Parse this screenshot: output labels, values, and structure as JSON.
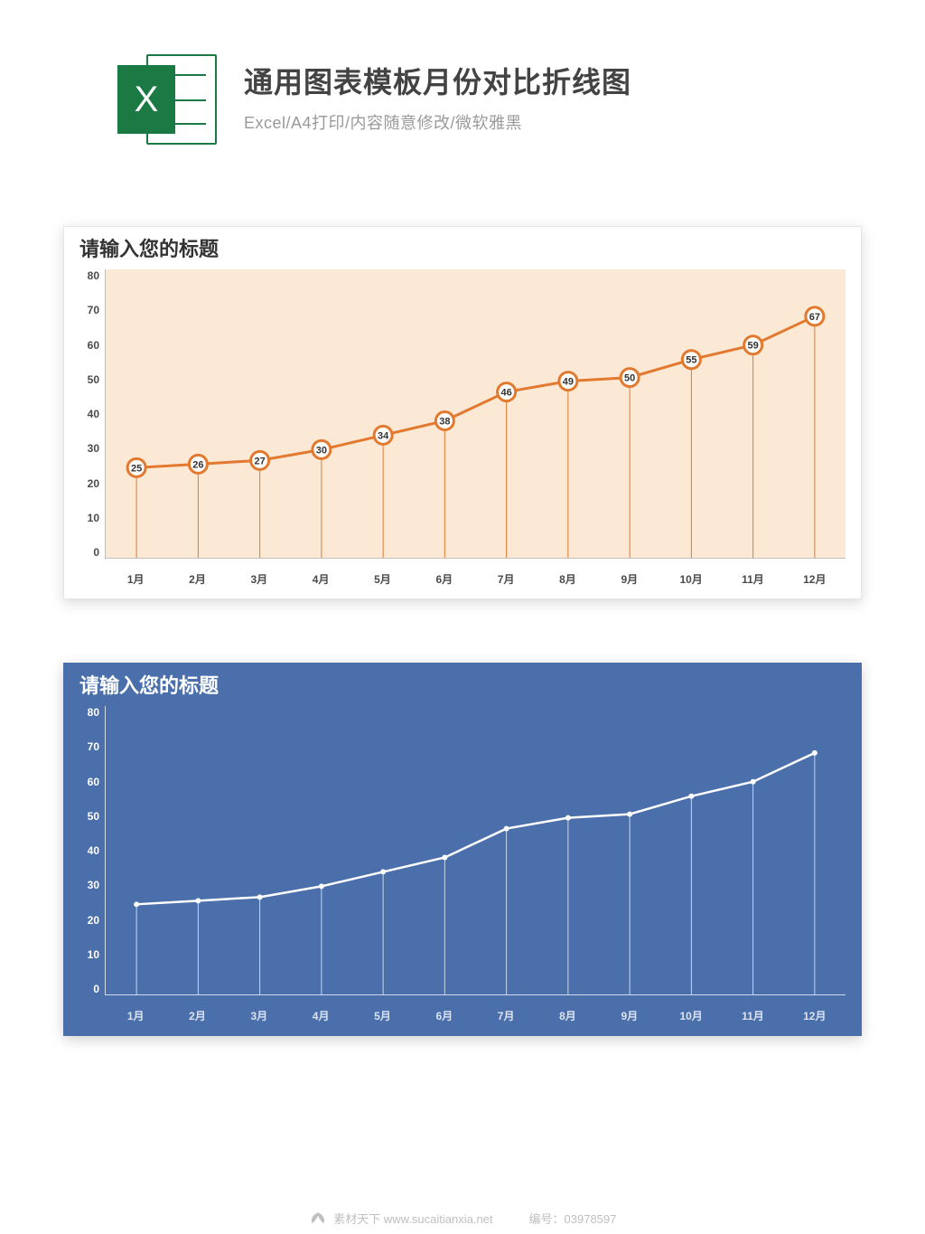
{
  "header": {
    "title": "通用图表模板月份对比折线图",
    "subtitle": "Excel/A4打印/内容随意修改/微软雅黑",
    "excel_letter": "X"
  },
  "charts": [
    {
      "title": "请输入您的标题",
      "theme": "light",
      "y_ticks": [
        "80",
        "70",
        "60",
        "50",
        "40",
        "30",
        "20",
        "10",
        "0"
      ],
      "x_ticks": [
        "1月",
        "2月",
        "3月",
        "4月",
        "5月",
        "6月",
        "7月",
        "8月",
        "9月",
        "10月",
        "11月",
        "12月"
      ],
      "values": [
        25,
        26,
        27,
        30,
        34,
        38,
        46,
        49,
        50,
        55,
        59,
        67
      ],
      "colors": {
        "line": "#e3792e",
        "marker_fill": "#fff",
        "marker_stroke": "#e3792e",
        "drop": "#e3792e",
        "label": "#333"
      }
    },
    {
      "title": "请输入您的标题",
      "theme": "blue",
      "y_ticks": [
        "80",
        "70",
        "60",
        "50",
        "40",
        "30",
        "20",
        "10",
        "0"
      ],
      "x_ticks": [
        "1月",
        "2月",
        "3月",
        "4月",
        "5月",
        "6月",
        "7月",
        "8月",
        "9月",
        "10月",
        "11月",
        "12月"
      ],
      "values": [
        25,
        26,
        27,
        30,
        34,
        38,
        46,
        49,
        50,
        55,
        59,
        67
      ],
      "colors": {
        "line": "#ffffff",
        "marker_fill": "#fff",
        "marker_stroke": "#fff",
        "drop": "#c9d4e8",
        "label": ""
      }
    }
  ],
  "footer": {
    "site": "素材天下 www.sucaitianxia.net",
    "id_label": "编号：",
    "id": "03978597"
  },
  "chart_data": [
    {
      "type": "line",
      "title": "请输入您的标题",
      "categories": [
        "1月",
        "2月",
        "3月",
        "4月",
        "5月",
        "6月",
        "7月",
        "8月",
        "9月",
        "10月",
        "11月",
        "12月"
      ],
      "values": [
        25,
        26,
        27,
        30,
        34,
        38,
        46,
        49,
        50,
        55,
        59,
        67
      ],
      "xlabel": "",
      "ylabel": "",
      "ylim": [
        0,
        80
      ],
      "y_ticks": [
        0,
        10,
        20,
        30,
        40,
        50,
        60,
        70,
        80
      ],
      "show_data_labels": true,
      "style": "orange markers with drop lines on peach plot area"
    },
    {
      "type": "line",
      "title": "请输入您的标题",
      "categories": [
        "1月",
        "2月",
        "3月",
        "4月",
        "5月",
        "6月",
        "7月",
        "8月",
        "9月",
        "10月",
        "11月",
        "12月"
      ],
      "values": [
        25,
        26,
        27,
        30,
        34,
        38,
        46,
        49,
        50,
        55,
        59,
        67
      ],
      "xlabel": "",
      "ylabel": "",
      "ylim": [
        0,
        80
      ],
      "y_ticks": [
        0,
        10,
        20,
        30,
        40,
        50,
        60,
        70,
        80
      ],
      "show_data_labels": false,
      "style": "white line with drop lines on blue background"
    }
  ]
}
